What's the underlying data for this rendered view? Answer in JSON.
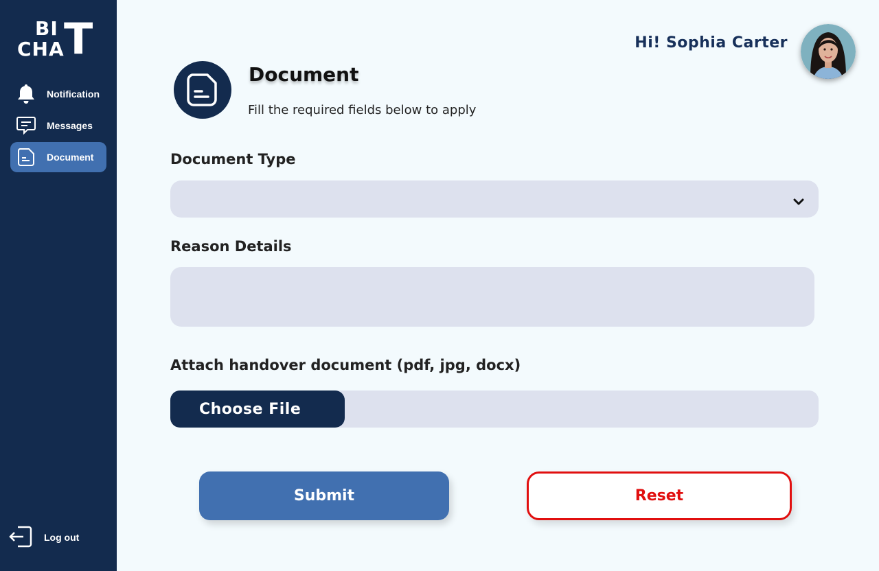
{
  "brand": {
    "line1": "BI",
    "line2": "CHA",
    "big_letter": "T"
  },
  "sidebar": {
    "items": [
      {
        "label": "Notification",
        "icon": "bell-icon"
      },
      {
        "label": "Messages",
        "icon": "chat-bubble-icon"
      },
      {
        "label": "Document",
        "icon": "document-icon",
        "active": true
      }
    ],
    "logout_label": "Log out"
  },
  "header": {
    "greeting": "Hi! Sophia Carter"
  },
  "page": {
    "title": "Document",
    "subtitle": "Fill the required fields below to apply"
  },
  "form": {
    "document_type_label": "Document Type",
    "document_type_value": "",
    "reason_label": "Reason Details",
    "reason_value": "",
    "attach_label": "Attach handover document (pdf, jpg, docx)",
    "choose_file_label": "Choose File",
    "submit_label": "Submit",
    "reset_label": "Reset"
  },
  "colors": {
    "sidebar_bg": "#132b4e",
    "accent": "#4170b0",
    "input_bg": "#dde1ee",
    "danger": "#e10f0f",
    "page_bg": "#f3fafd"
  }
}
